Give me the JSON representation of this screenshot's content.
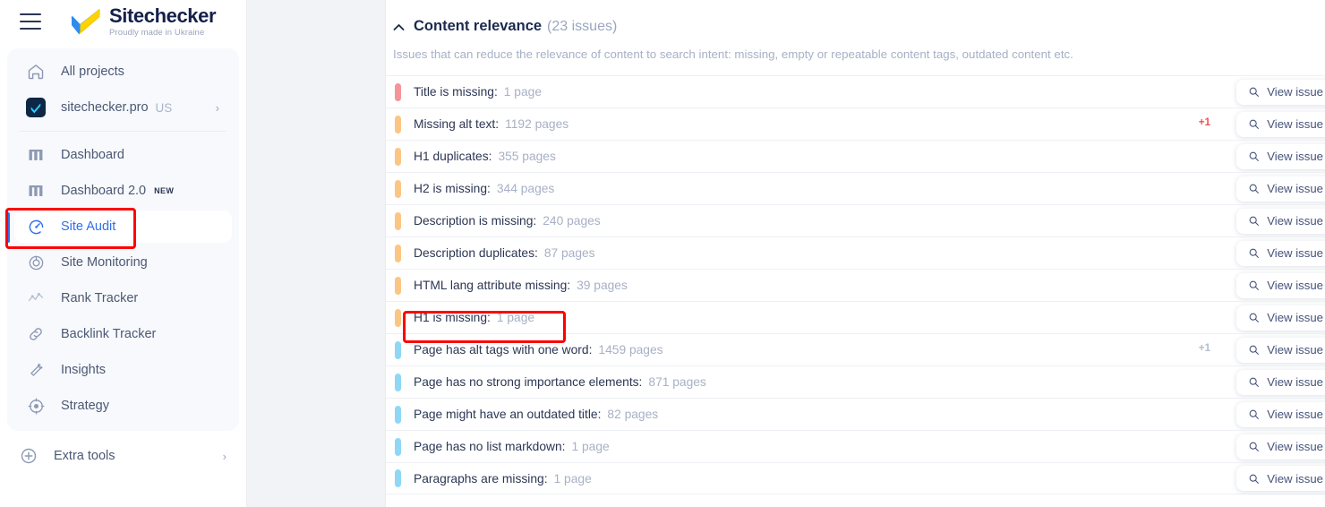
{
  "sidebar": {
    "menu_icon": "hamburger-icon",
    "brand": {
      "name": "Sitechecker",
      "tagline": "Proudly made in Ukraine"
    },
    "primary": [
      {
        "label": "All projects",
        "icon": "home-icon"
      },
      {
        "label": "sitechecker.pro",
        "region": "US",
        "icon": "site-favicon-icon",
        "chevron": "›"
      }
    ],
    "items": [
      {
        "label": "Dashboard",
        "icon": "dashboard-icon",
        "badge": "",
        "active": false
      },
      {
        "label": "Dashboard 2.0",
        "icon": "dashboard-icon",
        "badge": "NEW",
        "active": false
      },
      {
        "label": "Site Audit",
        "icon": "site-audit-icon",
        "badge": "",
        "active": true
      },
      {
        "label": "Site Monitoring",
        "icon": "site-monitoring-icon",
        "badge": "",
        "active": false
      },
      {
        "label": "Rank Tracker",
        "icon": "rank-tracker-icon",
        "badge": "",
        "active": false
      },
      {
        "label": "Backlink Tracker",
        "icon": "backlink-tracker-icon",
        "badge": "",
        "active": false
      },
      {
        "label": "Insights",
        "icon": "insights-icon",
        "badge": "",
        "active": false
      },
      {
        "label": "Strategy",
        "icon": "strategy-icon",
        "badge": "",
        "active": false
      }
    ],
    "extra": {
      "label": "Extra tools",
      "icon": "plus-circle-icon",
      "chevron": "›"
    }
  },
  "main": {
    "section": {
      "collapse_icon": "chevron-up-icon",
      "title": "Content relevance",
      "count": "(23 issues)",
      "description": "Issues that can reduce the relevance of content to search intent: missing, empty or repeatable content tags, outdated content etc."
    },
    "view_issue_label": "View issue",
    "search_icon": "magnifier-icon",
    "issues": [
      {
        "severity": "red",
        "name": "Title is missing:",
        "count": "1 page",
        "plus": ""
      },
      {
        "severity": "orange",
        "name": "Missing alt text:",
        "count": "1192 pages",
        "plus": "+1",
        "plus_color": "red"
      },
      {
        "severity": "orange",
        "name": "H1 duplicates:",
        "count": "355 pages",
        "plus": ""
      },
      {
        "severity": "orange",
        "name": "H2 is missing:",
        "count": "344 pages",
        "plus": ""
      },
      {
        "severity": "orange",
        "name": "Description is missing:",
        "count": "240 pages",
        "plus": ""
      },
      {
        "severity": "orange",
        "name": "Description duplicates:",
        "count": "87 pages",
        "plus": ""
      },
      {
        "severity": "orange",
        "name": "HTML lang attribute missing:",
        "count": "39 pages",
        "plus": ""
      },
      {
        "severity": "orange",
        "name": "H1 is missing:",
        "count": "1 page",
        "plus": ""
      },
      {
        "severity": "blue",
        "name": "Page has alt tags with one word:",
        "count": "1459 pages",
        "plus": "+1",
        "plus_color": "gray"
      },
      {
        "severity": "blue",
        "name": "Page has no strong importance elements:",
        "count": "871 pages",
        "plus": ""
      },
      {
        "severity": "blue",
        "name": "Page might have an outdated title:",
        "count": "82 pages",
        "plus": ""
      },
      {
        "severity": "blue",
        "name": "Page has no list markdown:",
        "count": "1 page",
        "plus": ""
      },
      {
        "severity": "blue",
        "name": "Paragraphs are missing:",
        "count": "1 page",
        "plus": ""
      }
    ]
  },
  "annotations": {
    "color": "#ff0000",
    "boxes": [
      {
        "name": "site-audit-highlight"
      },
      {
        "name": "h1-is-missing-highlight"
      }
    ]
  },
  "colors": {
    "accent_blue": "#2f6fed",
    "severity_red": "#f4949a",
    "severity_orange": "#fbc684",
    "severity_blue": "#8fd8f5",
    "annotation_red": "#ff0000"
  }
}
